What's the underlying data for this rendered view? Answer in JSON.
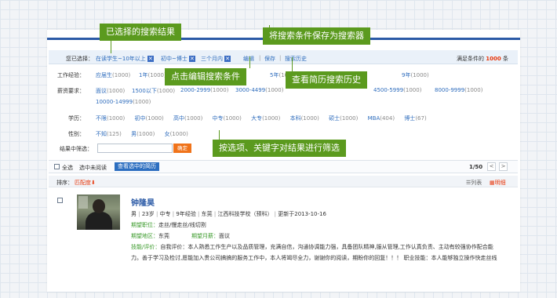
{
  "callouts": {
    "selected": "已选择的搜索结果",
    "save": "将搜索条件保存为搜索器",
    "edit": "点击编辑搜索条件",
    "history": "查看简历搜索历史",
    "filter": "按选项、关键字对结果进行筛选"
  },
  "selected": {
    "label": "您已选择：",
    "chips": [
      "在读学生~10年以上",
      "初中~博士",
      "三个月内"
    ],
    "actions": [
      "编辑",
      "保存",
      "搜索历史"
    ],
    "result_prefix": "满足条件的",
    "result_count": "1000",
    "result_suffix": "条"
  },
  "experience": {
    "label": "工作经验：",
    "items": [
      {
        "t": "应届生",
        "c": "(1000)"
      },
      {
        "t": "1年",
        "c": "(1000)"
      },
      {
        "t": "5年",
        "c": "(1000)"
      },
      {
        "t": "9年",
        "c": "(1000)"
      }
    ]
  },
  "salary": {
    "label": "薪资要求：",
    "row1": [
      {
        "t": "面议",
        "c": "(1000)"
      },
      {
        "t": "1500以下",
        "c": "(1000)"
      },
      {
        "t": "2000-2999",
        "c": "(1000)"
      },
      {
        "t": "3000-4499",
        "c": "(1000)"
      },
      {
        "t": "4500-5999",
        "c": "(1000)"
      },
      {
        "t": "8000-9999",
        "c": "(1000)"
      }
    ],
    "row2": [
      {
        "t": "10000-14999",
        "c": "(1000)"
      }
    ]
  },
  "education": {
    "label": "学历：",
    "items": [
      {
        "t": "不限",
        "c": "(1000)"
      },
      {
        "t": "初中",
        "c": "(1000)"
      },
      {
        "t": "高中",
        "c": "(1000)"
      },
      {
        "t": "中专",
        "c": "(1000)"
      },
      {
        "t": "大专",
        "c": "(1000)"
      },
      {
        "t": "本科",
        "c": "(1000)"
      },
      {
        "t": "硕士",
        "c": "(1000)"
      },
      {
        "t": "MBA",
        "c": "(404)"
      },
      {
        "t": "博士",
        "c": "(67)"
      }
    ]
  },
  "gender": {
    "label": "性别：",
    "items": [
      {
        "t": "不知",
        "c": "(125)"
      },
      {
        "t": "男",
        "c": "(1000)"
      },
      {
        "t": "女",
        "c": "(1000)"
      }
    ]
  },
  "search": {
    "label": "结果中筛选：",
    "value": "",
    "button": "确定"
  },
  "toolbar": {
    "select_all": "全选",
    "mark_read": "选中未阅读",
    "view_selected": "查看选中的简历",
    "page": "1/50",
    "prev": "<",
    "next": ">"
  },
  "sortbar": {
    "label": "排序：",
    "match": "匹配度",
    "list_view": "列表",
    "detail_view": "明细"
  },
  "resume": {
    "name": "钟隆昊",
    "meta": [
      "男",
      "23岁",
      "中专",
      "9年经验",
      "东莞",
      "江西科技学校（预科）",
      "更新于2013-10-16"
    ],
    "position_label": "期望职位：",
    "position": "走丝/慢走丝/线切割",
    "location_label": "期望地区：",
    "location": "东莞",
    "salary_label": "期望月薪：",
    "salary": "面议",
    "eval_label": "技能/评价：",
    "eval1": "自我评价：本人熟悉工作生产以及品质管理，充满自信，沟通协调能力强，具备团队精神,服从管理,工作认真负责、主动有较强协作配合能",
    "eval2": "力。善于学习及检讨,愿能加入贵公司搞搞的服务工作中，本人将竭尽全力，谢谢你的阅读，期盼你的回复！！！ 职业技能：本人能够独立操作快走丝线"
  }
}
